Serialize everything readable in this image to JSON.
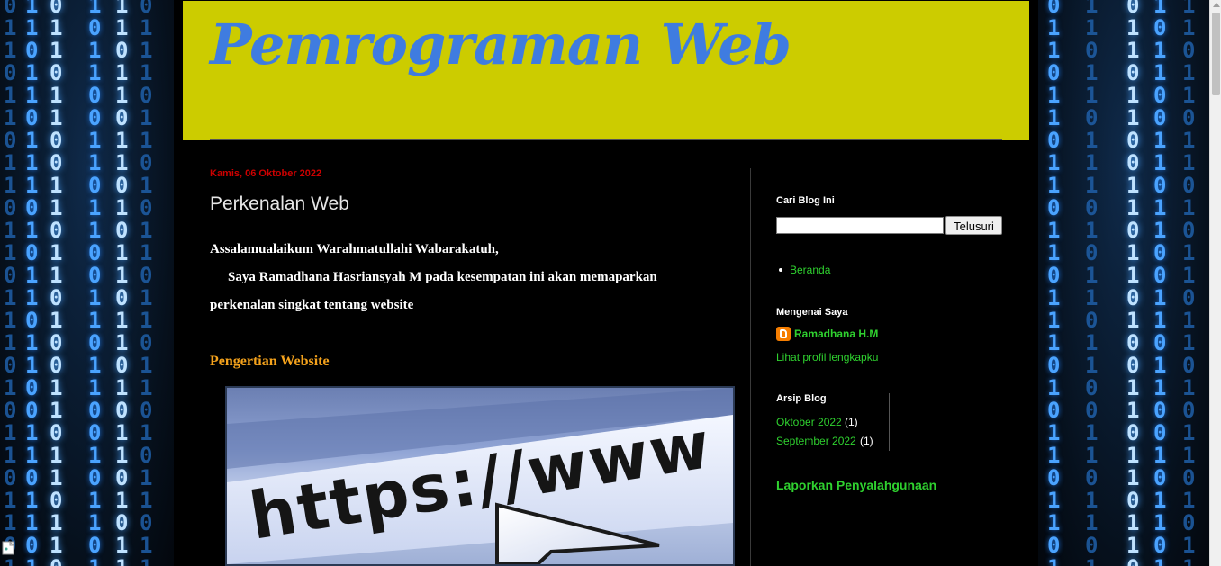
{
  "header": {
    "blog_title": "Pemrograman Web"
  },
  "post": {
    "date": "Kamis, 06 Oktober 2022",
    "title": "Perkenalan Web",
    "greeting": "Assalamualaikum Warahmatullahi Wabarakatuh,",
    "intro_line1": "Saya Ramadhana Hasriansyah M pada kesempatan ini akan memaparkan",
    "intro_line2": "perkenalan singkat tentang website",
    "section_heading": "Pengertian Website",
    "image_text": "https://www"
  },
  "sidebar": {
    "search_heading": "Cari Blog Ini",
    "search_button": "Telusuri",
    "pages": [
      {
        "label": "Beranda"
      }
    ],
    "about_heading": "Mengenai Saya",
    "profile_name": "Ramadhana H.M",
    "profile_link": "Lihat profil lengkapku",
    "archive_heading": "Arsip Blog",
    "archive": [
      {
        "label": "Oktober 2022",
        "count": "(1)"
      },
      {
        "label": "September 2022",
        "count": "(1)"
      }
    ],
    "report_link": "Laporkan Penyalahgunaan"
  },
  "colors": {
    "header_bg": "#cccc00",
    "title": "#3f7ce0",
    "date": "#cc0000",
    "section_heading": "#f4a21c",
    "link": "#2fd12f"
  }
}
